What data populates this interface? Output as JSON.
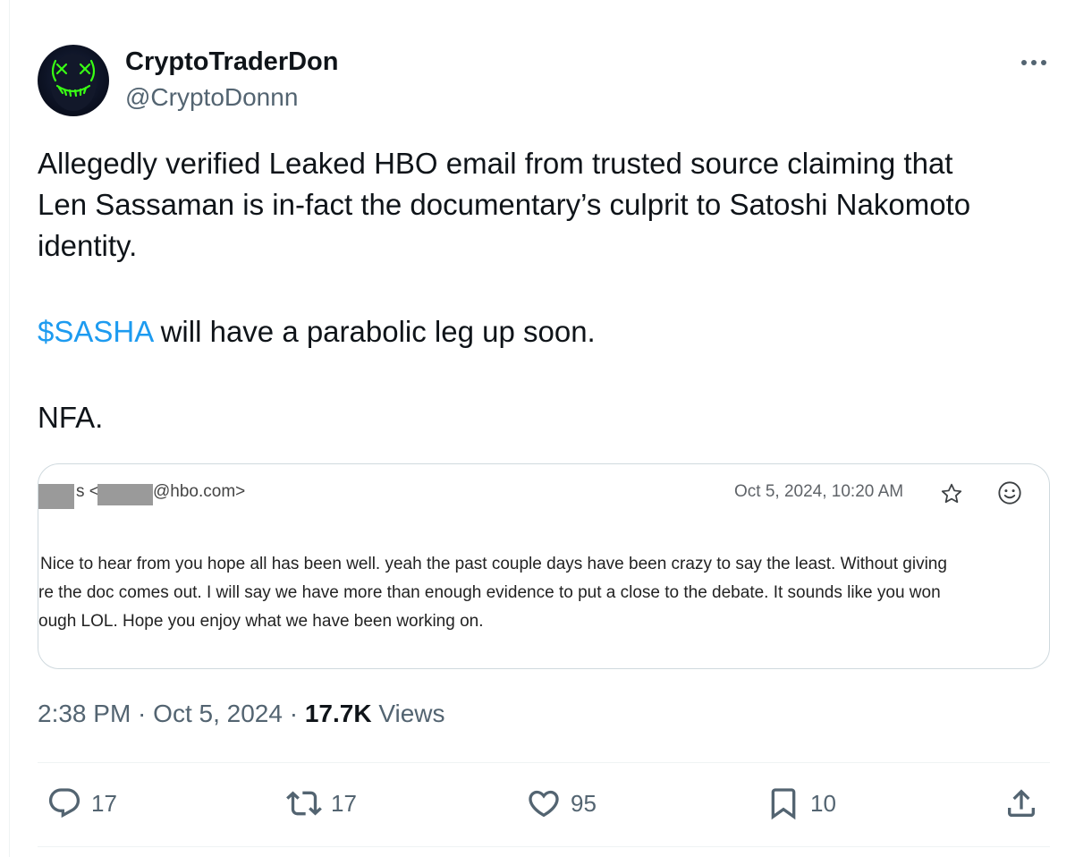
{
  "author": {
    "display_name": "CryptoTraderDon",
    "handle": "@CryptoDonnn"
  },
  "tweet": {
    "line1": "Allegedly verified Leaked HBO email from trusted source claiming that",
    "line2": "Len Sassaman is in-fact the documentary’s culprit to Satoshi Nakomoto",
    "line3": "identity.",
    "cashtag": "$SASHA",
    "line4_rest": " will have a parabolic leg up soon.",
    "line5": "NFA."
  },
  "email": {
    "sender_visible": "s <",
    "sender_domain": "@hbo.com>",
    "date": "Oct 5, 2024, 10:20 AM",
    "body_lines": [
      "Nice to hear from you hope all has been well. yeah the past couple days have been crazy to say the least. Without giving",
      "re the doc comes out. I will say we have more than enough evidence to put a close to the debate. It sounds like you won",
      "ough LOL. Hope you enjoy what we have been working on."
    ]
  },
  "meta": {
    "time": "2:38 PM",
    "separator": " · ",
    "date": "Oct 5, 2024",
    "views_count": "17.7K",
    "views_label": " Views"
  },
  "actions": {
    "replies": "17",
    "reposts": "17",
    "likes": "95",
    "bookmarks": "10"
  },
  "colors": {
    "link": "#1d9bf0",
    "secondary_text": "#536471",
    "avatar_glow": "#39ff14"
  },
  "icons": [
    "more-icon",
    "reply-icon",
    "repost-icon",
    "like-icon",
    "bookmark-icon",
    "share-icon",
    "star-icon",
    "emoji-icon"
  ]
}
